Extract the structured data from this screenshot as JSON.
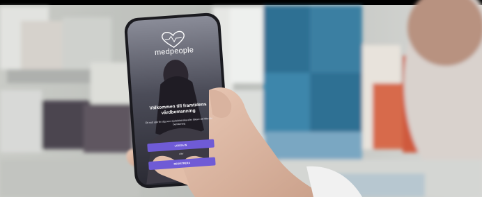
{
  "app": {
    "brand": "medpeople",
    "welcome_title": "Välkommen till framtidens vårdbemanning",
    "subtitle": "Ett nytt sätt för dig som sjuksköterska eller läkare att hitta din bemanning",
    "login_label": "LOGGA IN",
    "or_label": "eller",
    "register_label": "REGISTRERA"
  },
  "colors": {
    "accent": "#6f5bd6",
    "top_bar": "#000000"
  }
}
